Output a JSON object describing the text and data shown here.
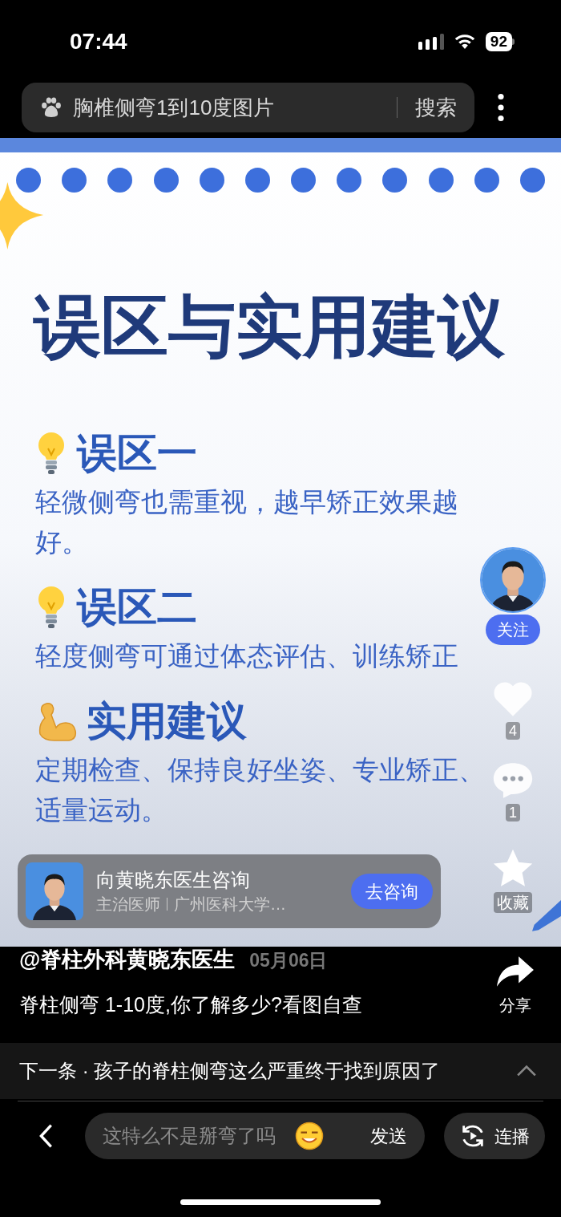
{
  "status_bar": {
    "time": "07:44",
    "battery": "92"
  },
  "search": {
    "query": "胸椎侧弯1到10度图片",
    "button": "搜索"
  },
  "slide": {
    "title": "误区与实用建议",
    "sections": [
      {
        "kind": "bulb",
        "heading": "误区一",
        "body": "轻微侧弯也需重视，越早矫正效果越好。"
      },
      {
        "kind": "bulb",
        "heading": "误区二",
        "body": "轻度侧弯可通过体态评估、训练矫正"
      },
      {
        "kind": "muscle",
        "heading": "实用建议",
        "body": "定期检查、保持良好坐姿、专业矫正、适量运动。"
      }
    ]
  },
  "actions": {
    "follow": "关注",
    "likes": "4",
    "comments": "1",
    "favorite": "收藏",
    "share": "分享"
  },
  "consult_card": {
    "title": "向黄晓东医生咨询",
    "role": "主治医师",
    "org": "广州医科大学…",
    "button": "去咨询"
  },
  "post": {
    "author": "@脊柱外科黄晓东医生",
    "date": "05月06日",
    "caption": "脊柱侧弯 1-10度,你了解多少?看图自查"
  },
  "next": {
    "label": "下一条 · 孩子的脊柱侧弯这么严重终于找到原因了"
  },
  "comment": {
    "placeholder": "这特么不是掰弯了吗",
    "send": "发送"
  },
  "autoplay": {
    "label": "连播"
  }
}
